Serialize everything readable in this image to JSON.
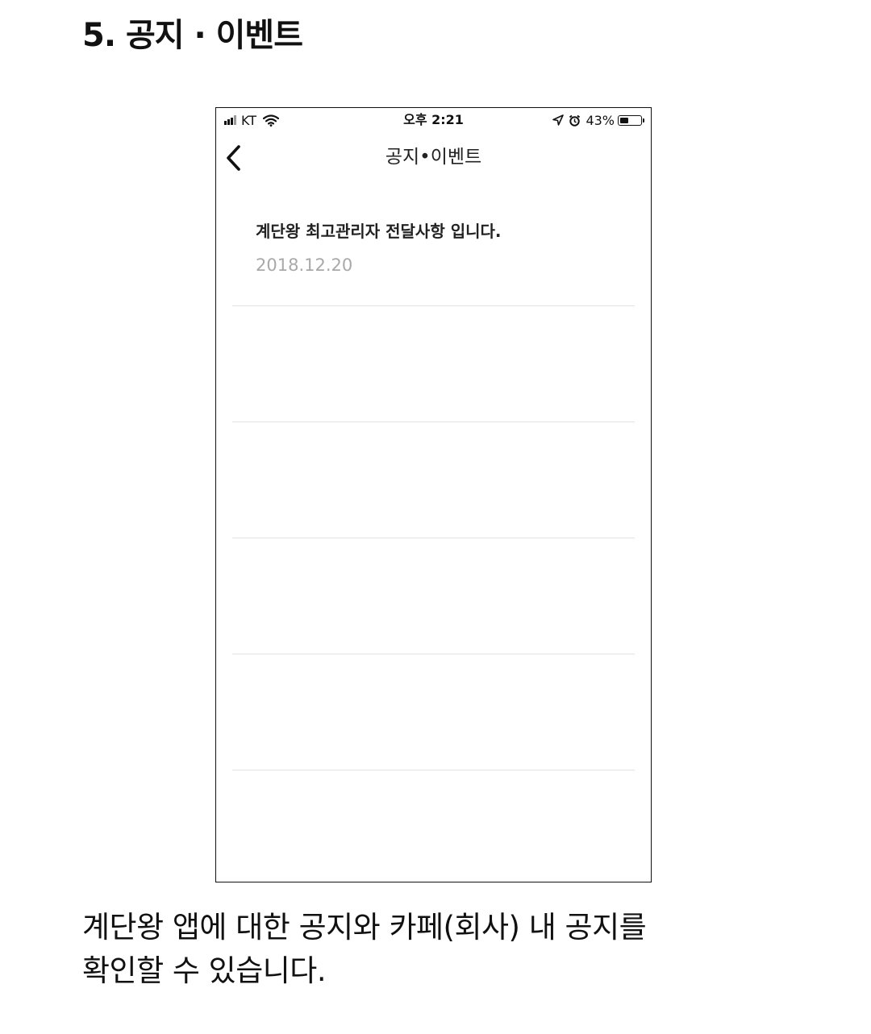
{
  "section_title": "5. 공지 · 이벤트",
  "phone": {
    "status_bar": {
      "carrier": "KT",
      "time": "오후 2:21",
      "battery_percent": "43%",
      "battery_level": 0.43,
      "icons": [
        "signal-icon",
        "wifi-icon",
        "location-arrow-icon",
        "alarm-clock-icon",
        "battery-icon"
      ]
    },
    "nav": {
      "back_icon": "chevron-left-icon",
      "title": "공지•이벤트"
    },
    "notices": [
      {
        "title": "계단왕 최고관리자 전달사항 입니다.",
        "date": "2018.12.20"
      },
      {
        "title": "",
        "date": ""
      },
      {
        "title": "",
        "date": ""
      },
      {
        "title": "",
        "date": ""
      },
      {
        "title": "",
        "date": ""
      }
    ]
  },
  "description": {
    "line1": "계단왕 앱에 대한 공지와 카페(회사) 내 공지를",
    "line2": "확인할 수 있습니다."
  }
}
